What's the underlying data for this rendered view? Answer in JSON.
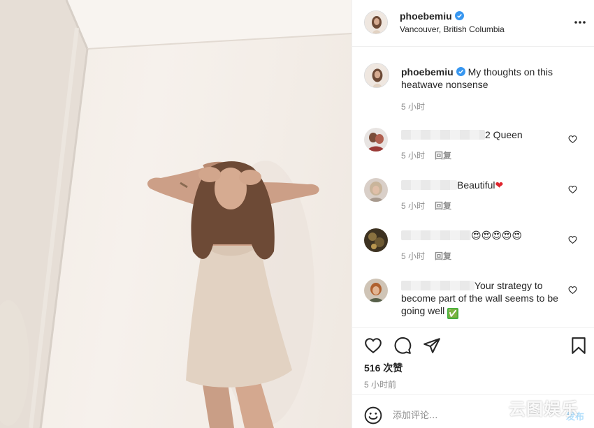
{
  "post": {
    "username": "phoebemiu",
    "location": "Vancouver, British Columbia",
    "caption": "My thoughts on this heatwave nonsense",
    "caption_time": "5 小时",
    "likes": "516 次赞",
    "time_ago": "5 小时前"
  },
  "comments": [
    {
      "text": "2 Queen",
      "emoji": "",
      "time": "5 小时",
      "reply": "回复"
    },
    {
      "text": "Beautiful",
      "emoji": "❤",
      "time": "5 小时",
      "reply": "回复"
    },
    {
      "text": "",
      "emoji": "😍😍😍😍😍",
      "time": "5 小时",
      "reply": "回复"
    },
    {
      "text": "Your strategy to become part of the wall seems to be going well",
      "emoji": "✅",
      "time": "",
      "reply": ""
    }
  ],
  "add_comment": {
    "placeholder": "添加评论...",
    "post_label": "发布"
  },
  "watermark": "云图娱乐",
  "icons": {
    "verified": "verified-badge-icon",
    "more": "more-options-icon",
    "like": "heart-icon",
    "comment": "comment-icon",
    "share": "paper-plane-icon",
    "save": "bookmark-icon",
    "emoji": "emoji-icon"
  },
  "colors": {
    "verified": "#3897f0",
    "muted_text": "#8e8e8e",
    "border": "#efefef"
  }
}
